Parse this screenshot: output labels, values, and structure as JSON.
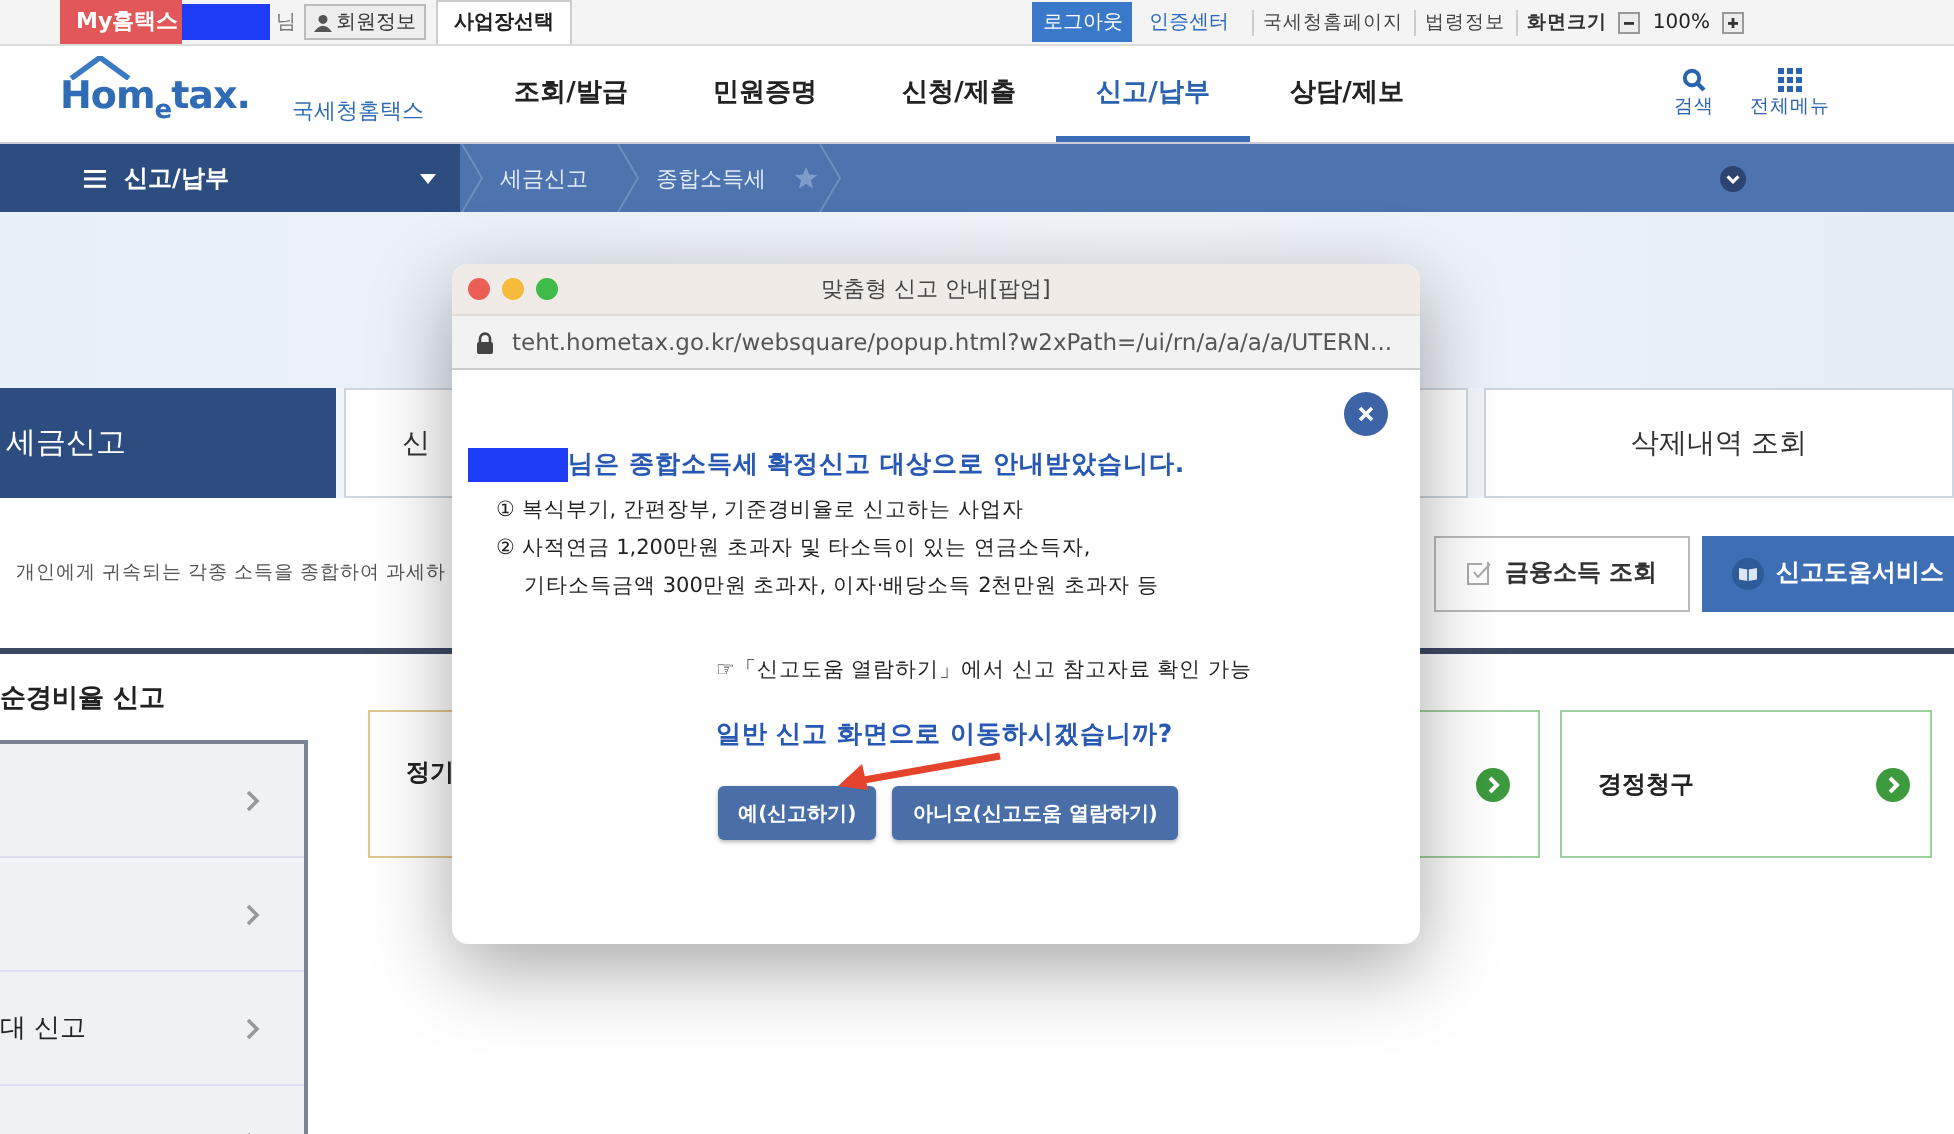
{
  "top_bar": {
    "my_hometax": "My홈택스",
    "user_suffix": "님",
    "member_info": "회원정보",
    "business_select": "사업장선택",
    "logout": "로그아웃",
    "cert_center": "인증센터",
    "links": [
      "국세청홈페이지",
      "법령정보"
    ],
    "zoom_label": "화면크기",
    "zoom_value": "100%"
  },
  "header": {
    "logo": "Hom$_{e}$tax.",
    "logo_sub": "국세청홈택스",
    "nav": [
      {
        "label": "조회/발급",
        "selected": false
      },
      {
        "label": "민원증명",
        "selected": false
      },
      {
        "label": "신청/제출",
        "selected": false
      },
      {
        "label": "신고/납부",
        "selected": true
      },
      {
        "label": "상담/제보",
        "selected": false
      }
    ],
    "search": "검색",
    "all_menu": "전체메뉴"
  },
  "nav_bar": {
    "menu": "신고/납부",
    "breadcrumbs": [
      "세금신고",
      "종합소득세"
    ]
  },
  "tabs": [
    {
      "label": "세금신고",
      "selected": true
    },
    {
      "label": "신",
      "selected": false
    },
    {
      "label": "삭제내역 조회",
      "selected": false
    }
  ],
  "description": "개인에게 귀속되는 각종 소득을 종합하여 과세하",
  "actions": [
    {
      "label": "금융소득 조회",
      "kind": "outline"
    },
    {
      "label": "신고도움서비스",
      "kind": "primary"
    }
  ],
  "section_title": "순경비율 신고",
  "side_list": [
    {
      "kind": "link"
    },
    {
      "kind": "link"
    },
    {
      "kind": "link",
      "label": "대 신고"
    },
    {
      "kind": "link"
    }
  ],
  "cards": [
    {
      "label": "정기",
      "color": "#e2c68c"
    },
    {
      "color": "#9bcf9b"
    },
    {
      "label": "경정청구",
      "color": "#9bcf9b"
    }
  ],
  "popup": {
    "title": "맞춤형 신고 안내[팝업]",
    "url": "teht.hometax.go.kr/websquare/popup.html?w2xPath=/ui/rn/a/a/a/a/UTERN...",
    "heading": "님은 종합소득세 확정신고 대상으로 안내받았습니다.",
    "items": [
      [
        "① 복식부기, 간편장부, 기준경비율로 신고하는 사업자"
      ],
      [
        "② 사적연금 1,200만원 초과자 및 타소득이 있는 연금소득자,",
        "기타소득금액 300만원 초과자, 이자·배당소득 2천만원 초과자 등"
      ]
    ],
    "note": "☞「신고도움 열람하기」에서 신고 참고자료 확인 가능",
    "question": "일반 신고 화면으로 이동하시겠습니까?",
    "buttons": [
      "예(신고하기)",
      "아니오(신고도움 열람하기)"
    ]
  }
}
